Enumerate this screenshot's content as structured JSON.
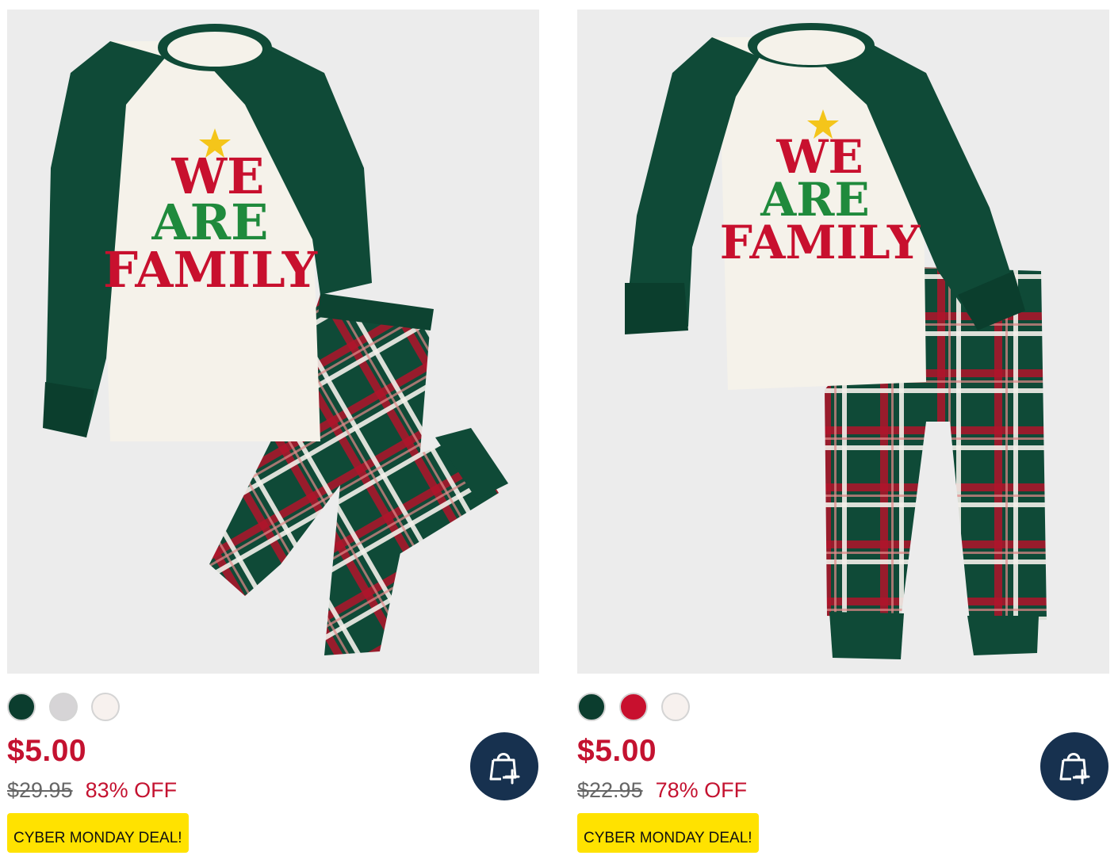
{
  "products": [
    {
      "shirt_text": [
        "WE",
        "ARE",
        "FAMILY"
      ],
      "swatches": [
        "#0b3d2e",
        "#d6d4d6",
        "#f7f1ee"
      ],
      "price": "$5.00",
      "original_price": "$29.95",
      "discount": "83% OFF",
      "badge": "CYBER MONDAY DEAL!"
    },
    {
      "shirt_text": [
        "WE",
        "ARE",
        "FAMILY"
      ],
      "swatches": [
        "#0b3d2e",
        "#c8102e",
        "#f7f1ee"
      ],
      "price": "$5.00",
      "original_price": "$22.95",
      "discount": "78% OFF",
      "badge": "CYBER MONDAY DEAL!"
    }
  ],
  "icons": {
    "add_to_bag": "shopping-bag-plus-icon"
  },
  "colors": {
    "price_red": "#c41230",
    "badge_yellow": "#ffe200",
    "button_navy": "#17314f"
  }
}
